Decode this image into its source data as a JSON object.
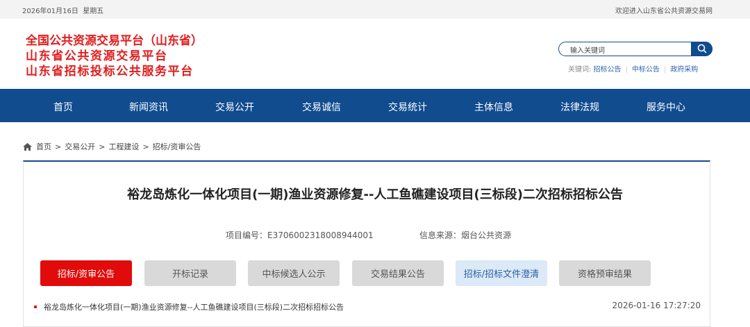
{
  "topbar": {
    "date": "2026年01月16日",
    "weekday": "星期五",
    "welcome": "欢迎进入山东省公共资源交易网"
  },
  "brand": {
    "line1": "全国公共资源交易平台（山东省）",
    "line2": "山东省公共资源交易平台",
    "line3": "山东省招标投标公共服务平台",
    "color": "#e11d1d"
  },
  "search": {
    "placeholder": "输入关键词",
    "icon": "search-icon"
  },
  "keywords": {
    "label": "关键词:",
    "items": [
      "招标公告",
      "中标公告",
      "政府采购"
    ]
  },
  "nav": {
    "color": "#114c8f",
    "items": [
      "首页",
      "新闻资讯",
      "交易公开",
      "交易诚信",
      "交易统计",
      "主体信息",
      "法律法规",
      "服务中心"
    ]
  },
  "breadcrumb": {
    "icon": "home-icon",
    "items": [
      "首页",
      "交易公开",
      "工程建设",
      "招标/资审公告"
    ]
  },
  "article": {
    "title": "裕龙岛炼化一体化项目(一期)渔业资源修复--人工鱼礁建设项目(三标段)二次招标招标公告",
    "project_code_label": "项目编号：",
    "project_code": "E3706002318008944001",
    "source_label": "信息来源：",
    "source": "烟台公共资源"
  },
  "tabs": [
    "招标/资审公告",
    "开标记录",
    "中标候选人公示",
    "交易结果公告",
    "招标/招标文件澄清",
    "资格预审结果"
  ],
  "list": [
    {
      "title": "裕龙岛炼化一体化项目(一期)渔业资源修复--人工鱼礁建设项目(三标段)二次招标招标公告",
      "time": "2026-01-16 17:27:20"
    }
  ]
}
